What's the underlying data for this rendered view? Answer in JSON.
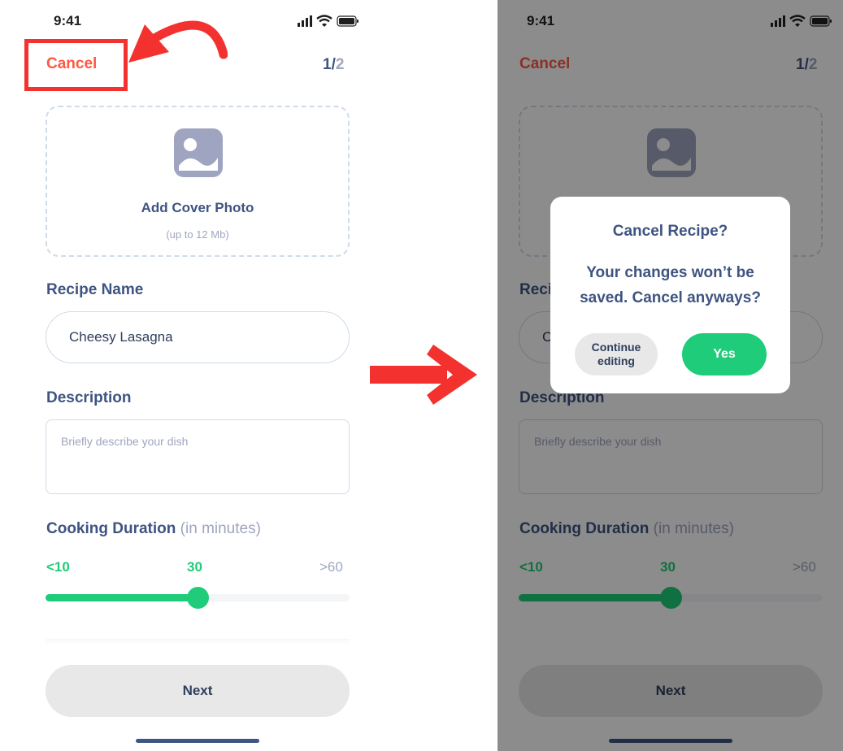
{
  "status_bar": {
    "time": "9:41",
    "icons": [
      "signal-icon",
      "wifi-icon",
      "battery-icon"
    ]
  },
  "header": {
    "cancel_label": "Cancel",
    "step_current": "1/",
    "step_total": "2"
  },
  "cover_photo": {
    "icon": "image-icon",
    "title": "Add Cover Photo",
    "hint": "(up to 12 Mb)"
  },
  "recipe_name": {
    "label": "Recipe Name",
    "value": "Cheesy Lasagna",
    "short_label": "Reci",
    "short_value": "C"
  },
  "description": {
    "label": "Description",
    "placeholder": "Briefly describe your dish"
  },
  "cooking_duration": {
    "label": "Cooking Duration",
    "unit": "(in minutes)",
    "min_label": "<10",
    "value_label": "30",
    "max_label": ">60",
    "value_fraction": 0.5
  },
  "next_label": "Next",
  "dialog": {
    "title": "Cancel Recipe?",
    "message": "Your changes won’t be saved. Cancel anyways?",
    "continue_label": "Continue editing",
    "yes_label": "Yes"
  },
  "colors": {
    "accent_green": "#1fcc79",
    "cancel_red": "#ff5842",
    "annotation_red": "#f3322f",
    "text_primary": "#3e5481",
    "text_secondary": "#9fa5c0"
  }
}
